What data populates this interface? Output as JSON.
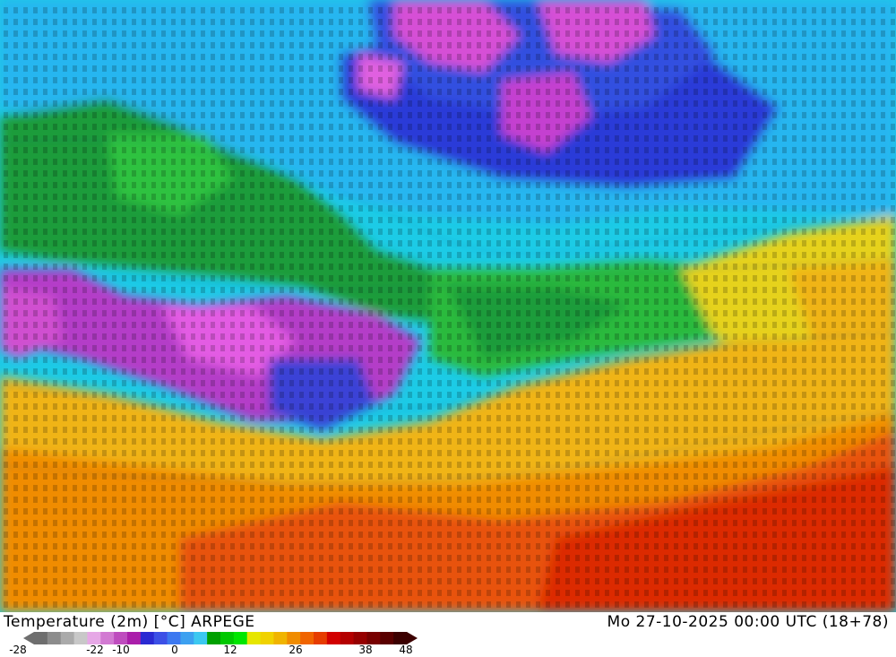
{
  "title": "Temperature (2m) [°C] ARPEGE",
  "valid_time": "Mo 27-10-2025 00:00 UTC (18+78)",
  "colorbar": {
    "ticks": [
      "-28",
      "-22",
      "-10",
      "0",
      "12",
      "26",
      "38",
      "48"
    ],
    "colors": [
      "#6e6e6e",
      "#8c8c8c",
      "#aaaaaa",
      "#c8c8c8",
      "#e6a8e6",
      "#d27ad2",
      "#be4cbe",
      "#aa1eaa",
      "#2a2ad2",
      "#3c50e6",
      "#3c78f0",
      "#3ca0f0",
      "#3cc8f0",
      "#00a000",
      "#00c800",
      "#00e600",
      "#e6e600",
      "#f0d200",
      "#f0b400",
      "#f08c00",
      "#f06400",
      "#e63c00",
      "#d20000",
      "#b40000",
      "#960000",
      "#780000",
      "#5a0000",
      "#3c0000"
    ]
  },
  "map_colors": {
    "ocean_cold": "#1ad0ec",
    "ocean_mid": "#21b4f0",
    "land_green": "#1e9a3a",
    "land_light_green": "#3cc83c",
    "cold_blue": "#2a2ad2",
    "cold_magenta": "#e050e0",
    "warm_yellow": "#f0c81e",
    "warm_orange": "#f08c00",
    "hot_red": "#e63c00"
  }
}
